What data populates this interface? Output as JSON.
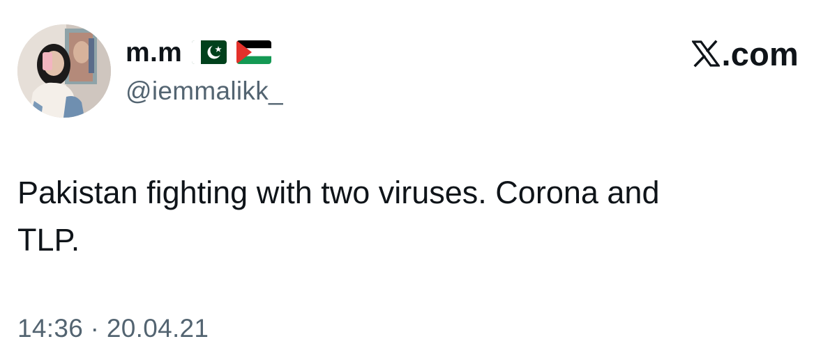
{
  "tweet": {
    "author": {
      "display_name": "m.m",
      "handle": "@iemmalikk_",
      "flags": [
        "pakistan-flag-icon",
        "palestine-flag-icon"
      ]
    },
    "text": "Pakistan fighting with two viruses. Corona and\nTLP.",
    "timestamp": "14:36 · 20.04.21"
  },
  "brand": {
    "icon": "x-logo-icon",
    "label": ".com"
  },
  "colors": {
    "text_primary": "#0f1419",
    "text_secondary": "#536471",
    "background": "#ffffff",
    "pakistan_green": "#01411c",
    "palestine_red": "#e4312b",
    "palestine_green": "#149954"
  }
}
